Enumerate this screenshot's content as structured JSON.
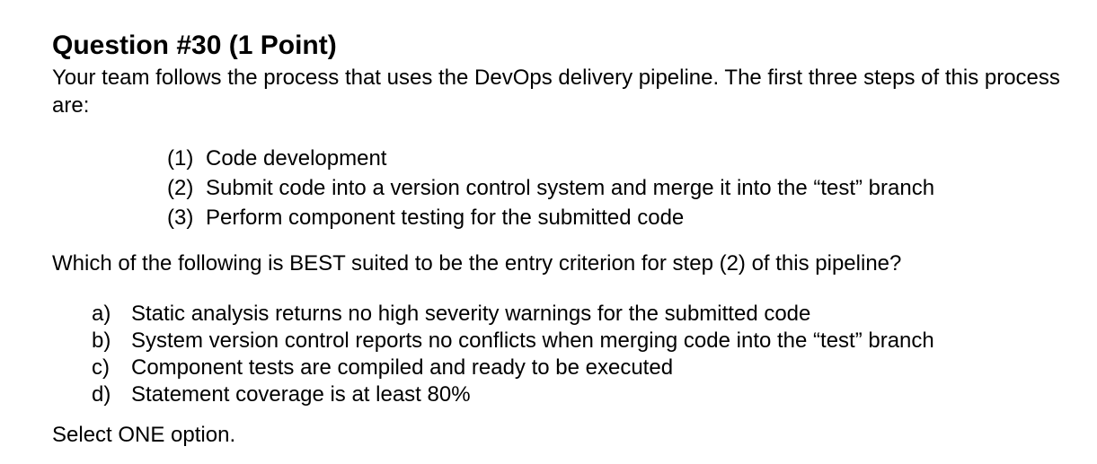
{
  "question": {
    "title": "Question #30 (1 Point)",
    "intro": "Your team follows the process that uses the DevOps delivery pipeline. The first three steps of this process are:",
    "steps": [
      {
        "num": "(1)",
        "text": "Code development"
      },
      {
        "num": "(2)",
        "text": "Submit code into a version control system and merge it into the “test” branch"
      },
      {
        "num": "(3)",
        "text": "Perform component testing for the submitted code"
      }
    ],
    "prompt": "Which of the following is BEST suited to be the entry criterion for step (2) of this pipeline?",
    "options": [
      {
        "letter": "a)",
        "text": "Static analysis returns no high severity warnings for the submitted code"
      },
      {
        "letter": "b)",
        "text": "System version control reports no conflicts when merging code into the “test” branch"
      },
      {
        "letter": "c)",
        "text": "Component tests are compiled and ready to be executed"
      },
      {
        "letter": "d)",
        "text": "Statement coverage is at least 80%"
      }
    ],
    "instruction": "Select ONE option."
  }
}
